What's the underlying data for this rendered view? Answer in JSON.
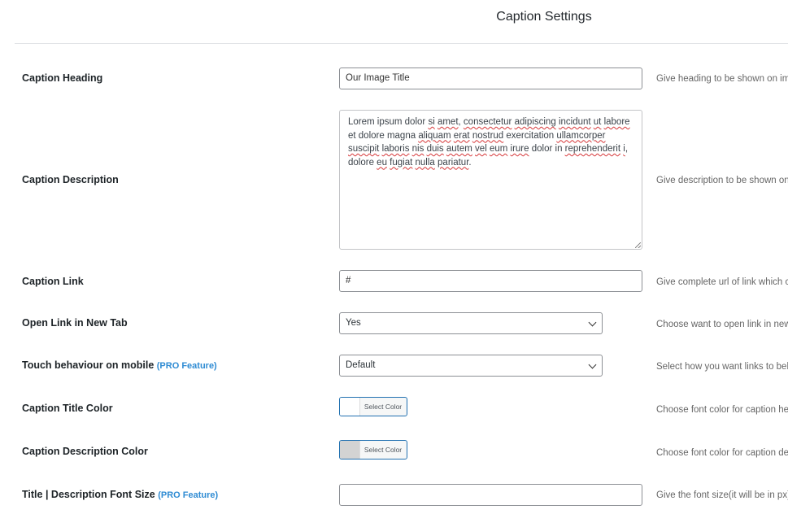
{
  "header": {
    "title": "Caption Settings"
  },
  "rows": {
    "heading": {
      "label": "Caption Heading",
      "value": "Our Image Title",
      "help": "Give heading to be shown on im"
    },
    "description": {
      "label": "Caption Description",
      "value_words": [
        "Lorem ipsum dolor ",
        "si",
        " ",
        "amet",
        ", ",
        "consectetur",
        " ",
        "adipiscing",
        " ",
        "incidunt",
        " ",
        "ut",
        " ",
        "labore",
        " et dolore magna ",
        "aliquam",
        " ",
        "erat",
        " ",
        "nostrud",
        " exercitation ",
        "ullamcorper",
        " ",
        "suscipit",
        " ",
        "laboris",
        " ",
        "nis",
        " ",
        "duis",
        " ",
        "autem",
        " ",
        "vel",
        " ",
        "eum",
        " ",
        "irure",
        " dolor in ",
        "reprehenderit",
        " ",
        "i",
        ", dolore ",
        "eu",
        " ",
        "fugiat",
        " ",
        "nulla",
        " ",
        "pariatur",
        "."
      ],
      "help": "Give description to be shown on"
    },
    "link": {
      "label": "Caption Link",
      "value": "#",
      "help": "Give complete url of link which c"
    },
    "new_tab": {
      "label": "Open Link in New Tab",
      "value": "Yes",
      "help": "Choose want to open link in new"
    },
    "touch": {
      "label": "Touch behaviour on mobile",
      "pro": "(PRO Feature)",
      "value": "Default",
      "help": "Select how you want links to beh"
    },
    "title_color": {
      "label": "Caption Title Color",
      "button": "Select Color",
      "swatch": "#ffffff",
      "help": "Choose font color for caption he"
    },
    "desc_color": {
      "label": "Caption Description Color",
      "button": "Select Color",
      "swatch": "#d3d3d3",
      "help": "Choose font color for caption de"
    },
    "font_size": {
      "label": "Title | Description Font Size",
      "pro": "(PRO Feature)",
      "value": "",
      "help": "Give the font size(it will be in px)"
    }
  }
}
